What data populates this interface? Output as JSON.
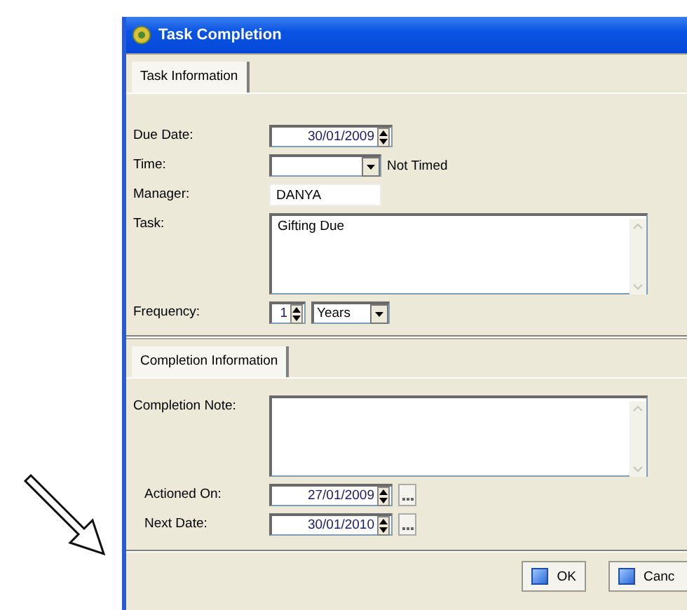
{
  "window": {
    "title": "Task Completion"
  },
  "task_tabs": [
    {
      "label": "Task Information",
      "selected": true
    }
  ],
  "task_fields": [
    {
      "kind": "date",
      "label": "Due Date:",
      "value": "30/01/2009"
    },
    {
      "kind": "combo",
      "label": "Time:",
      "note": "Not Timed"
    },
    {
      "kind": "text",
      "label": "Manager:",
      "value": "DANYA"
    },
    {
      "kind": "memo",
      "label": "Task:",
      "value": "Gifting Due"
    },
    {
      "kind": "frequency",
      "label": "Frequency:",
      "value": "1",
      "unit": "Years"
    }
  ],
  "completion_tabs": [
    {
      "label": "Completion Information",
      "selected": true
    }
  ],
  "completion_fields": [
    {
      "kind": "memo",
      "label": "Completion Note:"
    },
    {
      "kind": "datepick",
      "label": "Actioned On:",
      "value": "27/01/2009"
    },
    {
      "kind": "datepick",
      "label": "Next Date:",
      "value": "30/01/2010"
    }
  ],
  "buttons": [
    {
      "label": "OK"
    },
    {
      "label": "Canc"
    }
  ]
}
